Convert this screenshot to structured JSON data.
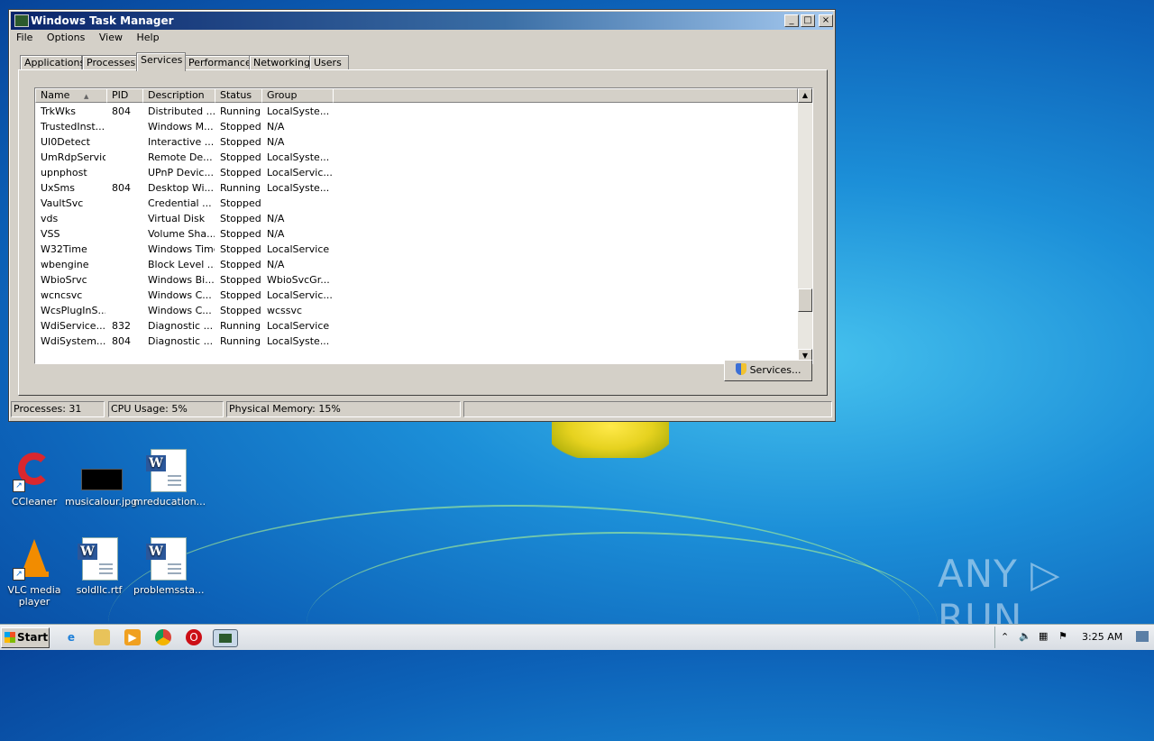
{
  "window": {
    "title": "Windows Task Manager",
    "controls": [
      "_",
      "□",
      "×"
    ],
    "menu": [
      "File",
      "Options",
      "View",
      "Help"
    ],
    "tabs": [
      "Applications",
      "Processes",
      "Services",
      "Performance",
      "Networking",
      "Users"
    ],
    "active_tab": "Services"
  },
  "services": {
    "columns": [
      "Name",
      "PID",
      "Description",
      "Status",
      "Group"
    ],
    "sort_indicator": "▲",
    "rows": [
      [
        "TrkWks",
        "804",
        "Distributed ...",
        "Running",
        "LocalSyste..."
      ],
      [
        "TrustedInst...",
        "",
        "Windows M...",
        "Stopped",
        "N/A"
      ],
      [
        "UI0Detect",
        "",
        "Interactive ...",
        "Stopped",
        "N/A"
      ],
      [
        "UmRdpService",
        "",
        "Remote De...",
        "Stopped",
        "LocalSyste..."
      ],
      [
        "upnphost",
        "",
        "UPnP Devic...",
        "Stopped",
        "LocalServic..."
      ],
      [
        "UxSms",
        "804",
        "Desktop Wi...",
        "Running",
        "LocalSyste..."
      ],
      [
        "VaultSvc",
        "",
        "Credential ...",
        "Stopped",
        ""
      ],
      [
        "vds",
        "",
        "Virtual Disk",
        "Stopped",
        "N/A"
      ],
      [
        "VSS",
        "",
        "Volume Sha...",
        "Stopped",
        "N/A"
      ],
      [
        "W32Time",
        "",
        "Windows Time",
        "Stopped",
        "LocalService"
      ],
      [
        "wbengine",
        "",
        "Block Level ...",
        "Stopped",
        "N/A"
      ],
      [
        "WbioSrvc",
        "",
        "Windows Bi...",
        "Stopped",
        "WbioSvcGr..."
      ],
      [
        "wcncsvc",
        "",
        "Windows C...",
        "Stopped",
        "LocalServic..."
      ],
      [
        "WcsPlugInS...",
        "",
        "Windows C...",
        "Stopped",
        "wcssvc"
      ],
      [
        "WdiService...",
        "832",
        "Diagnostic ...",
        "Running",
        "LocalService"
      ],
      [
        "WdiSystem...",
        "804",
        "Diagnostic ...",
        "Running",
        "LocalSyste..."
      ]
    ],
    "services_button": "Services..."
  },
  "statusbar": {
    "processes": "Processes: 31",
    "cpu": "CPU Usage: 5%",
    "memory": "Physical Memory: 15%"
  },
  "desktop_icons": [
    {
      "label": "CCleaner",
      "icon": "ccleaner-icon"
    },
    {
      "label": "musicalour.jpg",
      "icon": "image-file-icon"
    },
    {
      "label": "mreducation...",
      "icon": "word-doc-icon"
    },
    {
      "label": "VLC media player",
      "icon": "vlc-icon"
    },
    {
      "label": "soldllc.rtf",
      "icon": "word-doc-icon"
    },
    {
      "label": "problemssta...",
      "icon": "word-doc-icon"
    }
  ],
  "watermark": "ANY ▷ RUN",
  "taskbar": {
    "start_label": "Start",
    "pinned": [
      "internet-explorer-icon",
      "explorer-icon",
      "media-player-icon",
      "chrome-icon",
      "opera-icon",
      "task-manager-icon"
    ],
    "clock": "3:25 AM"
  },
  "colors": {
    "title_gradient_start": "#0a246a",
    "window_face": "#d4d0c8",
    "desktop_blue": "#1c8fd8"
  }
}
